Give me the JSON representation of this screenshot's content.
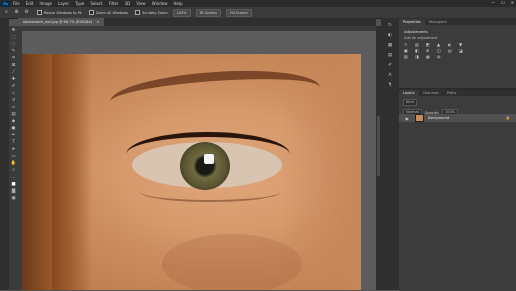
{
  "menubar": {
    "logo": "Ps",
    "items": [
      "File",
      "Edit",
      "Image",
      "Layer",
      "Type",
      "Select",
      "Filter",
      "3D",
      "View",
      "Window",
      "Help"
    ],
    "window_controls": [
      "—",
      "☐",
      "✕"
    ]
  },
  "options": {
    "zoom_in_icon": "zoom-in",
    "resize_label": "Resize Windows to Fit",
    "zoom_all_label": "Zoom All Windows",
    "scrubby_label": "Scrubby Zoom",
    "btn_100": "100%",
    "btn_fit": "Fit Screen",
    "btn_fill": "Fill Screen"
  },
  "document": {
    "tab_title": "adobestock_eye.jpg @ 66.7% (RGB/8#)",
    "close": "×"
  },
  "panels": {
    "tabs": [
      "Properties",
      "Histogram"
    ],
    "adjustments_title": "Adjustments",
    "adjustments_sub": "Add an adjustment",
    "adj_icons": [
      "☼",
      "▥",
      "◩",
      "▲",
      "◐",
      "▼",
      "▣",
      "◧",
      "⊞",
      "◫",
      "▤",
      "◪",
      "▧",
      "◨",
      "▦",
      "◍",
      "▩",
      "◉"
    ],
    "layer_tabs": [
      "Layers",
      "Channels",
      "Paths"
    ],
    "kind_label": "Kind",
    "blend_mode": "Normal",
    "opacity_label": "Opacity:",
    "opacity_value": "100%",
    "lock_label": "Lock:",
    "fill_label": "Fill:",
    "fill_value": "100%",
    "layer_name": "Background",
    "layer_lock": "🔒"
  },
  "colors": {
    "app_bg": "#535353",
    "panel_bg": "#3c3c3c",
    "accent": "#31a8ff"
  }
}
